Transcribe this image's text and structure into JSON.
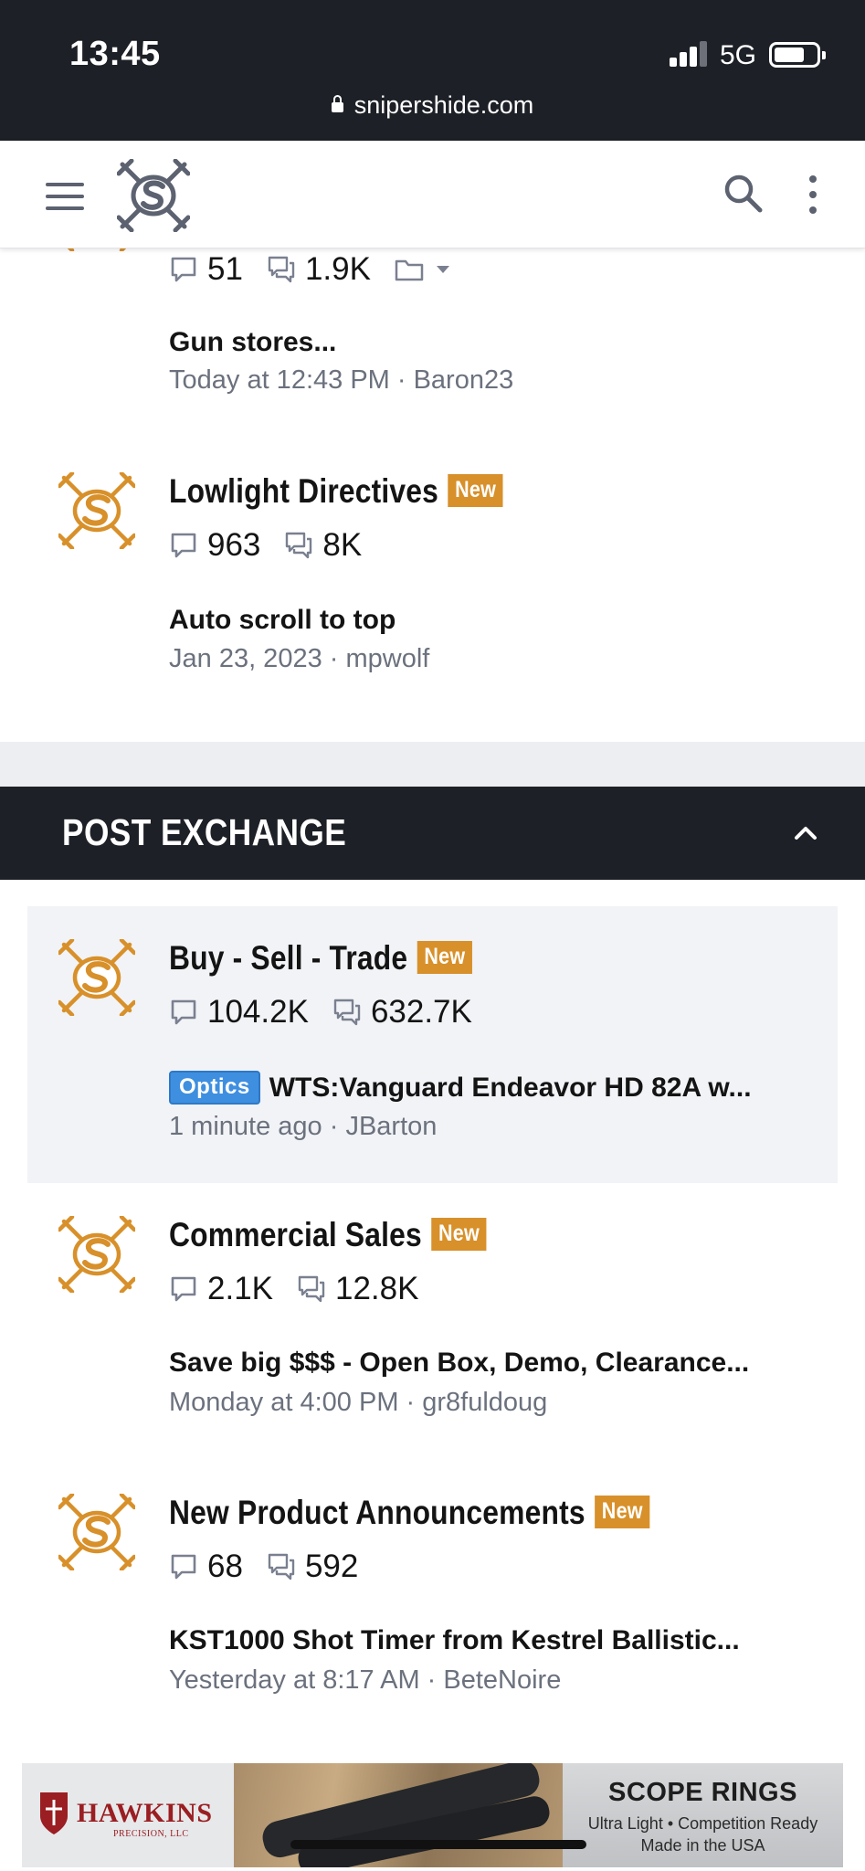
{
  "status_bar": {
    "time": "13:45",
    "network": "5G",
    "url": "snipershide.com"
  },
  "header": {
    "menu_icon": "hamburger-menu-icon",
    "logo": "snipershide-logo",
    "search_icon": "search-icon",
    "more_icon": "more-vertical-icon"
  },
  "colors": {
    "accent": "#d8902a",
    "dark": "#1d2026",
    "prefix_blue": "#3f8fe0",
    "meta_gray": "#6b717d"
  },
  "top_forum": {
    "threads": "51",
    "messages": "1.9K",
    "latest_title": "Gun stores...",
    "latest_meta": "Today at 12:43 PM · Baron23"
  },
  "lowlight": {
    "title": "Lowlight Directives",
    "badge": "New",
    "threads": "963",
    "messages": "8K",
    "latest_title": "Auto scroll to top",
    "latest_meta": "Jan 23, 2023 · mpwolf"
  },
  "section": {
    "title": "POST EXCHANGE"
  },
  "forums": [
    {
      "title": "Buy - Sell - Trade",
      "badge": "New",
      "threads": "104.2K",
      "messages": "632.7K",
      "prefix": "Optics",
      "latest_title": "WTS:Vanguard Endeavor HD 82A w...",
      "latest_meta": "1 minute ago · JBarton"
    },
    {
      "title": "Commercial Sales",
      "badge": "New",
      "threads": "2.1K",
      "messages": "12.8K",
      "latest_title": "Save big $$$ - Open Box, Demo, Clearance...",
      "latest_meta": "Monday at 4:00 PM · gr8fuldoug"
    },
    {
      "title": "New Product Announcements",
      "badge": "New",
      "threads": "68",
      "messages": "592",
      "latest_title": "KST1000 Shot Timer from Kestrel Ballistic...",
      "latest_meta": "Yesterday at 8:17 AM · BeteNoire"
    }
  ],
  "ad": {
    "brand": "HAWKINS",
    "brand_sub": "PRECISION, LLC",
    "headline": "SCOPE RINGS",
    "tagline": "Ultra Light • Competition Ready",
    "tagline2": "Made in the USA"
  }
}
